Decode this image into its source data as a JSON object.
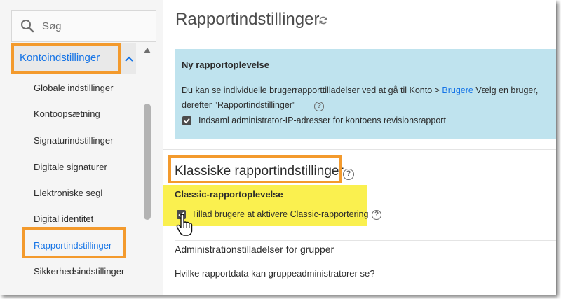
{
  "search": {
    "label": "Søg"
  },
  "sidebar": {
    "parent_label": "Kontoindstillinger",
    "items": [
      {
        "label": "Globale indstillinger"
      },
      {
        "label": "Kontoopsætning"
      },
      {
        "label": "Signaturindstillinger"
      },
      {
        "label": "Digitale signaturer"
      },
      {
        "label": "Elektroniske segl"
      },
      {
        "label": "Digital identitet"
      },
      {
        "label": "Rapportindstillinger",
        "active": true
      },
      {
        "label": "Sikkerhedsindstillinger"
      }
    ]
  },
  "header": {
    "title": "Rapportindstillinger"
  },
  "info_box": {
    "title": "Ny rapportoplevelse",
    "text_before_link": "Du kan se individuelle brugerrapporttilladelser ved at gå til Konto > ",
    "link_label": "Brugere",
    "text_after_link": " Vælg en bruger, derefter \"Rapportindstillinger\"",
    "checkbox_label": "Indsaml administrator-IP-adresser for kontoens revisionsrapport",
    "checkbox_checked": true
  },
  "classic": {
    "section_title": "Klassiske rapportindstillinger",
    "subtitle": "Classic-rapportoplevelse",
    "checkbox_label": "Tillad brugere at aktivere Classic-rapportering",
    "checkbox_checked": true
  },
  "groups": {
    "heading": "Administrationstilladelser for grupper",
    "question": "Hvilke rapportdata kan gruppeadministratorer se?"
  },
  "help_glyph": "?",
  "colors": {
    "accent": "#1473e6",
    "highlight_border": "#f39a2d",
    "highlight_fill": "#faf04f",
    "info_bg": "#bfe3ee"
  }
}
